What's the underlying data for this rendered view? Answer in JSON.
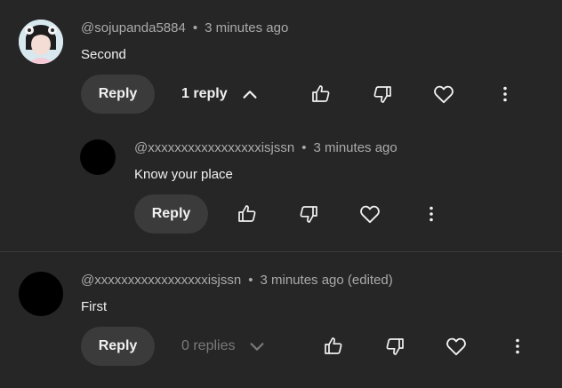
{
  "comments": [
    {
      "username": "@sojupanda5884",
      "separator": "•",
      "time": "3 minutes ago",
      "text": "Second",
      "reply_label": "Reply",
      "replies_label": "1 reply",
      "replies": [
        {
          "username": "@xxxxxxxxxxxxxxxxxisjssn",
          "separator": "•",
          "time": "3 minutes ago",
          "text": "Know your place",
          "reply_label": "Reply"
        }
      ]
    },
    {
      "username": "@xxxxxxxxxxxxxxxxxisjssn",
      "separator": "•",
      "time": "3 minutes ago (edited)",
      "text": "First",
      "reply_label": "Reply",
      "replies_label": "0 replies"
    }
  ],
  "icons": {
    "like": "thumb-up-icon",
    "dislike": "thumb-down-icon",
    "heart": "heart-icon",
    "more": "more-vert-icon",
    "chevron_up": "chevron-up-icon",
    "chevron_down": "chevron-down-icon"
  },
  "colors": {
    "background": "#262626",
    "button": "#3b3b3b",
    "muted_text": "#aaaaaa"
  }
}
